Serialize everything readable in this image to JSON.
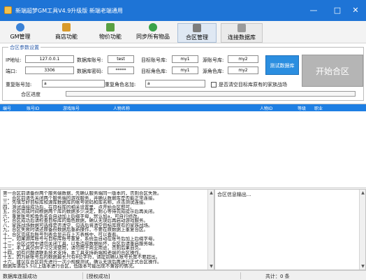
{
  "window": {
    "title": "新端超梦GM工具V4.9升级版 新端老端通用",
    "minimize_glyph": "—",
    "maximize_glyph": "□",
    "close_glyph": "✕",
    "title_bg": "#1e74d6"
  },
  "toolbar": {
    "tabs": [
      {
        "label": "GM管理",
        "icon": "user-icon",
        "color": "#3b82d6"
      },
      {
        "label": "商店功能",
        "icon": "shop-icon",
        "color": "#d99a2b"
      },
      {
        "label": "物价功能",
        "icon": "price-icon",
        "color": "#5aa042"
      },
      {
        "label": "同步所有物品",
        "icon": "sync-icon",
        "color": "#3aa34a"
      },
      {
        "label": "合区管理",
        "icon": "merge-icon",
        "color": "#7d7d7d"
      },
      {
        "label": "连接数据库",
        "icon": "database-icon",
        "color": "#9a9a9a"
      }
    ],
    "active_index": 4
  },
  "merge_settings": {
    "group_title": "合区参数设置",
    "ip_label": "IP地址:",
    "ip_value": "127.0.0.1",
    "port_label": "端口:",
    "port_value": "3306",
    "db_account_label": "数据库账号:",
    "db_account_value": "test",
    "db_password_label": "数据库密码:",
    "db_password_value": "*****",
    "target_account_db_label": "目标账号库:",
    "target_account_db_value": "my1",
    "target_role_db_label": "目标角色库:",
    "target_role_db_value": "my1",
    "source_account_db_label": "源账号库:",
    "source_account_db_value": "my2",
    "source_role_db_label": "源角色库:",
    "source_role_db_value": "my2",
    "test_button": "测试数据库",
    "merge_button": "开始合区",
    "dup_account_label": "重复账号加:",
    "dup_account_value": "a",
    "dup_role_label": "重复角色名加:",
    "dup_role_value": "a",
    "clear_checkbox_label": "是否清空目标库原有的家族战场",
    "progress_label": "合区进度",
    "progress_fraction": 0.0
  },
  "table": {
    "columns": [
      "编号",
      "账号ID",
      "游戏账号",
      "人物名称",
      "人物ID",
      "等级",
      "职业"
    ],
    "rows": []
  },
  "log": {
    "lines": [
      "第一合区前请备份两个服务端数据，先确认服务端同一版本的，否则合区失败。",
      "二，合区前请先关闭两个服务端的游戏服务，并确认数据库是否能正常连接。",
      "三，先填写好目标库和源库数据库的账号密码和库名称，点击测试连接。",
      "四，测试连接成功后，在目标库的相关设置里，点开始合区即可。",
      "五，合区完成时间根据两个库的数据多少决定，耐心等待完成提示后再关闭。",
      "六，重复账号和角色名会自动加上后缀字母，默认加a，可自行修改。",
      "七，合区成功后请检查目标库的角色数据，确认无误后再启动游戏服务。",
      "八，家族战场数据可选择是否清空，勾选后将清空目标库原有的家族战场。",
      "九，合区失败时请还原备份数据后重新操作，不要在原数据上重复合区。",
      "十，合区完成后账号列表会显示在上方表格中，可以查看。",
      "十一，如果源库账号与目标库账号重复，系统会自动在账号后加上后缀字母。",
      "十二，合区过程中请勿关闭工具，以免造成数据损坏，合区后请重启服务端。",
      "十三，本工具仅供学习交流使用，请勿用于商业用途，否则后果自负。",
      "十四，如有问题请联系技术支持，本工具支持新端和老端的合区操作。",
      "十五，因为新账号后的数据最长只有8位字符，请提前确认账号长度不要超出。",
      "十六，建议在合区前先进行一次小规模测试，确认无误后再进行正式合区操作。",
      "数据库请在5.5以上版本进行合区，低版本可能出现不兼容的情况。"
    ]
  },
  "output": {
    "title": "合区信息输出..."
  },
  "statusbar": {
    "db_status": "数据库连接成功",
    "license_status": "[授权成功]",
    "total": "共计：0 条"
  }
}
